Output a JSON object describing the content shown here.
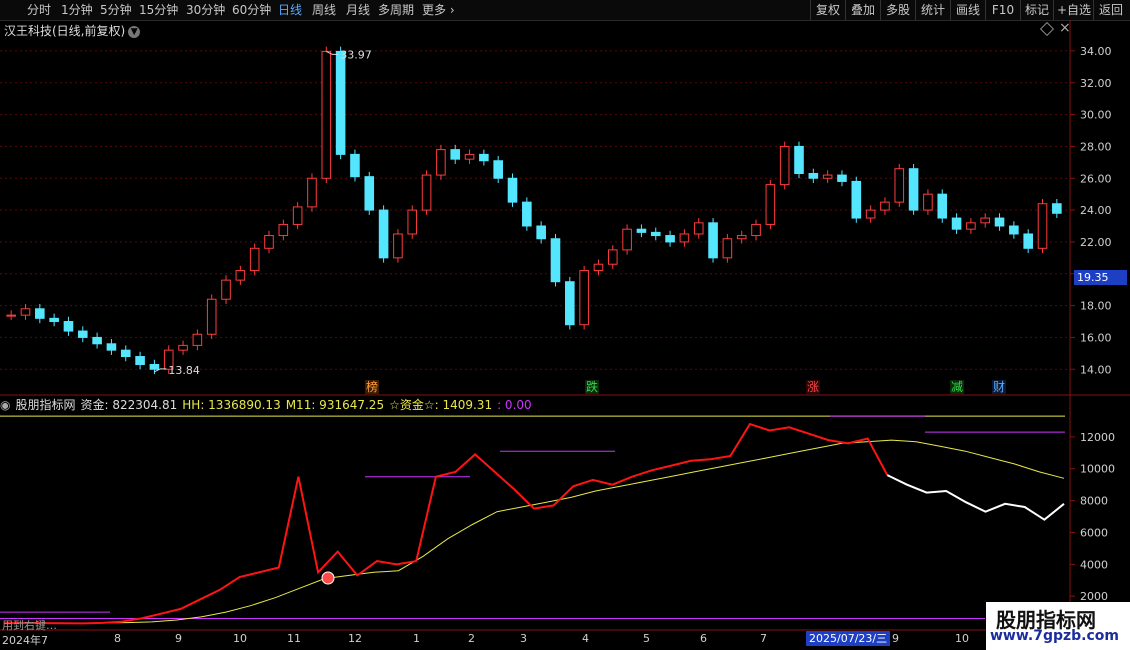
{
  "toolbar": {
    "left_items": [
      "分时",
      "1分钟",
      "5分钟",
      "15分钟",
      "30分钟",
      "60分钟",
      "日线",
      "周线",
      "月线",
      "多周期",
      "更多"
    ],
    "active": "日线",
    "right_items": [
      "复权",
      "叠加",
      "多股",
      "统计",
      "画线",
      "F10",
      "标记",
      "+自选",
      "返回"
    ]
  },
  "stock_title": "汉王科技(日线,前复权)",
  "price_axis": [
    "34.00",
    "32.00",
    "30.00",
    "28.00",
    "26.00",
    "24.00",
    "22.00",
    "20.00",
    "18.00",
    "16.00",
    "14.00"
  ],
  "current_price": "19.35",
  "annotations": {
    "high": "33.97",
    "low": "13.84"
  },
  "events": [
    {
      "label": "榜",
      "color": "#ff9e3d",
      "bg": "#3a1c00"
    },
    {
      "label": "跌",
      "color": "#2fdc4a",
      "bg": "#0b2a0b"
    },
    {
      "label": "涨",
      "color": "#ff4040",
      "bg": "#2a0808"
    },
    {
      "label": "减",
      "color": "#2fdc4a",
      "bg": "#0b2a0b"
    },
    {
      "label": "财",
      "color": "#5aa9ff",
      "bg": "#0a1a33"
    }
  ],
  "indicator": {
    "name": "股朋指标网",
    "zijin": "资金: 822304.81",
    "hh": "HH: 1336890.13",
    "m11": "M11: 931647.25",
    "star": "☆资金☆: 1409.31",
    "zero": ": 0.00"
  },
  "indicator_axis": [
    "12000",
    "10000",
    "8000",
    "6000",
    "4000",
    "2000"
  ],
  "x_labels": [
    "2024年7",
    "8",
    "9",
    "10",
    "11",
    "12",
    "1",
    "2",
    "3",
    "4",
    "5",
    "6",
    "7",
    "9",
    "10"
  ],
  "cursor_date": "2025/07/23/三",
  "watermark": {
    "title": "股朋指标网",
    "url": "www.7gpzb.com"
  },
  "bottom_hint": "用到右键…",
  "colors": {
    "up": "#ff3c3c",
    "down": "#54e6ff",
    "line_red": "#ff1414",
    "line_white": "#ffffff",
    "line_yellow": "#e8e84a",
    "magenta": "#cc33ff",
    "accent": "#1d3fc4"
  },
  "chart_data": {
    "type": "line",
    "candle_closes": [
      17.4,
      17.8,
      17.2,
      17.0,
      16.4,
      16.0,
      15.6,
      15.2,
      14.8,
      14.3,
      14.0,
      15.2,
      15.5,
      16.2,
      18.4,
      19.6,
      20.2,
      21.6,
      22.4,
      23.1,
      24.2,
      26.0,
      33.97,
      27.5,
      26.1,
      24.0,
      21.0,
      22.5,
      24.0,
      26.2,
      27.8,
      27.2,
      27.5,
      27.1,
      26.0,
      24.5,
      23.0,
      22.2,
      19.5,
      16.8,
      20.2,
      20.6,
      21.5,
      22.8,
      22.6,
      22.4,
      22.0,
      22.5,
      23.2,
      21.0,
      22.2,
      22.4,
      23.1,
      25.6,
      28.0,
      26.3,
      26.0,
      26.2,
      25.8,
      23.5,
      24.0,
      24.5,
      26.6,
      24.0,
      25.0,
      23.5,
      22.8,
      23.2,
      23.5,
      23.0,
      22.5,
      21.6,
      24.4,
      23.8
    ],
    "price_ylim": [
      13.2,
      35.0
    ],
    "indicator_series": [
      {
        "name": "资金",
        "values": [
          300,
          320,
          310,
          300,
          290,
          320,
          400,
          600,
          900,
          1200,
          1800,
          2400,
          3200,
          3500,
          3800,
          9500,
          3500,
          4800,
          3300,
          4200,
          4000,
          4200,
          9500,
          9800,
          10900,
          9800,
          8700,
          7500,
          7700,
          8900,
          9300,
          9000,
          9500,
          9900,
          10200,
          10500,
          10600,
          10800,
          12800,
          12400,
          12600,
          12200,
          11800,
          11600,
          11900,
          9600,
          9000,
          8500,
          8600,
          7900,
          7300,
          7800,
          7600,
          6800,
          7800
        ]
      },
      {
        "name": "M11",
        "values": [
          300,
          300,
          300,
          310,
          320,
          340,
          380,
          500,
          700,
          1000,
          1400,
          1900,
          2500,
          3100,
          3300,
          3500,
          3600,
          4500,
          5600,
          6500,
          7300,
          7600,
          7900,
          8200,
          8600,
          8900,
          9200,
          9500,
          9800,
          10100,
          10400,
          10700,
          11000,
          11300,
          11600,
          11700,
          11800,
          11700,
          11400,
          11100,
          10700,
          10300,
          9800,
          9400
        ]
      }
    ],
    "indicator_ylim": [
      0,
      13500
    ]
  }
}
